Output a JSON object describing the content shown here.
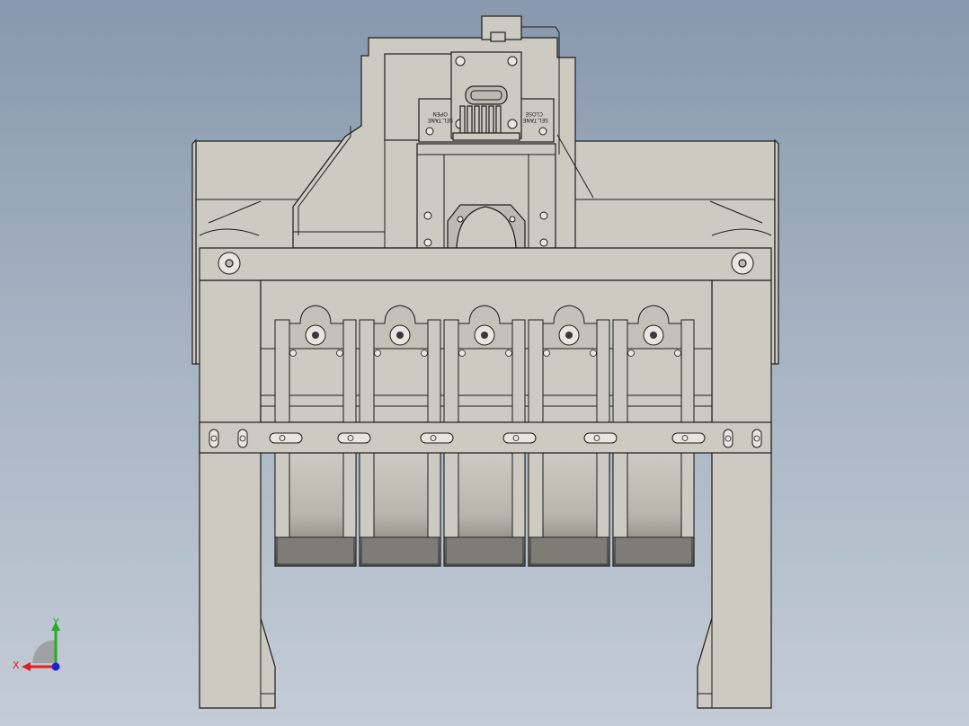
{
  "viewport": {
    "background_top": "#8898ad",
    "background_bottom": "#c4ccd6",
    "part_fill": "#cdcbc1",
    "edge_color": "#1c1c1c"
  },
  "model": {
    "label_left_top": "OPEN",
    "label_left_bottom": "SEL.TANE",
    "label_right_top": "CLOSE",
    "label_right_bottom": "SEL.TANE",
    "finger_count": 5
  },
  "triad": {
    "x_label": "X",
    "y_label": "Y",
    "x_color": "#e02020",
    "y_color": "#20b020",
    "z_color": "#2020d0"
  }
}
